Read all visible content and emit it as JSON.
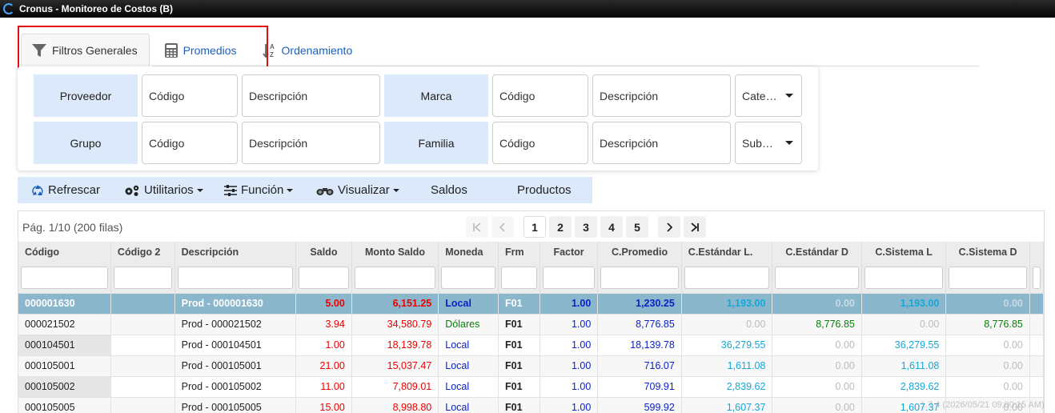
{
  "window": {
    "title": "Cronus - Monitoreo de Costos (B)"
  },
  "tabs": [
    {
      "label": "Filtros Generales",
      "icon": "filter-icon",
      "active": true
    },
    {
      "label": "Promedios",
      "icon": "calculator-icon",
      "active": false
    },
    {
      "label": "Ordenamiento",
      "icon": "sort-az-icon",
      "active": false
    }
  ],
  "filters": {
    "row1": {
      "left_label": "Proveedor",
      "left_code": "Código",
      "left_desc": "Descripción",
      "right_label": "Marca",
      "right_code": "Código",
      "right_desc": "Descripción",
      "select": "Cate…"
    },
    "row2": {
      "left_label": "Grupo",
      "left_code": "Código",
      "left_desc": "Descripción",
      "right_label": "Familia",
      "right_code": "Código",
      "right_desc": "Descripción",
      "select": "Sub…"
    }
  },
  "toolbar": {
    "refresh": "Refrescar",
    "utilities": "Utilitarios",
    "function": "Función",
    "view": "Visualizar",
    "balances": "Saldos",
    "products": "Productos"
  },
  "pager": {
    "info": "Pág. 1/10 (200 filas)",
    "pages": [
      "1",
      "2",
      "3",
      "4",
      "5"
    ],
    "current": "1"
  },
  "grid": {
    "columns": [
      "Código",
      "Código 2",
      "Descripción",
      "Saldo",
      "Monto Saldo",
      "Moneda",
      "Frm",
      "Factor",
      "C.Promedio",
      "C.Estándar L.",
      "C.Estándar D",
      "C.Sistema L",
      "C.Sistema D"
    ],
    "rows": [
      [
        "000001630",
        "",
        "Prod - 000001630",
        "5.00",
        "6,151.25",
        "Local",
        "F01",
        "1.00",
        "1,230.25",
        "1,193.00",
        "0.00",
        "1,193.00",
        "0.00"
      ],
      [
        "000021502",
        "",
        "Prod - 000021502",
        "3.94",
        "34,580.79",
        "Dólares",
        "F01",
        "1.00",
        "8,776.85",
        "0.00",
        "8,776.85",
        "0.00",
        "8,776.85"
      ],
      [
        "000104501",
        "",
        "Prod - 000104501",
        "1.00",
        "18,139.78",
        "Local",
        "F01",
        "1.00",
        "18,139.78",
        "36,279.55",
        "0.00",
        "36,279.55",
        "0.00"
      ],
      [
        "000105001",
        "",
        "Prod - 000105001",
        "21.00",
        "15,037.47",
        "Local",
        "F01",
        "1.00",
        "716.07",
        "1,611.08",
        "0.00",
        "1,611.08",
        "0.00"
      ],
      [
        "000105002",
        "",
        "Prod - 000105002",
        "11.00",
        "7,809.01",
        "Local",
        "F01",
        "1.00",
        "709.91",
        "2,839.62",
        "0.00",
        "2,839.62",
        "0.00"
      ],
      [
        "000105005",
        "",
        "Prod - 000105005",
        "15.00",
        "8,998.80",
        "Local",
        "F01",
        "1.00",
        "599.92",
        "1,607.37",
        "0.00",
        "1,607.37",
        "0.00"
      ]
    ]
  },
  "watermark": "1.7.4 (2026/05/21 09:00:15 AM)"
}
